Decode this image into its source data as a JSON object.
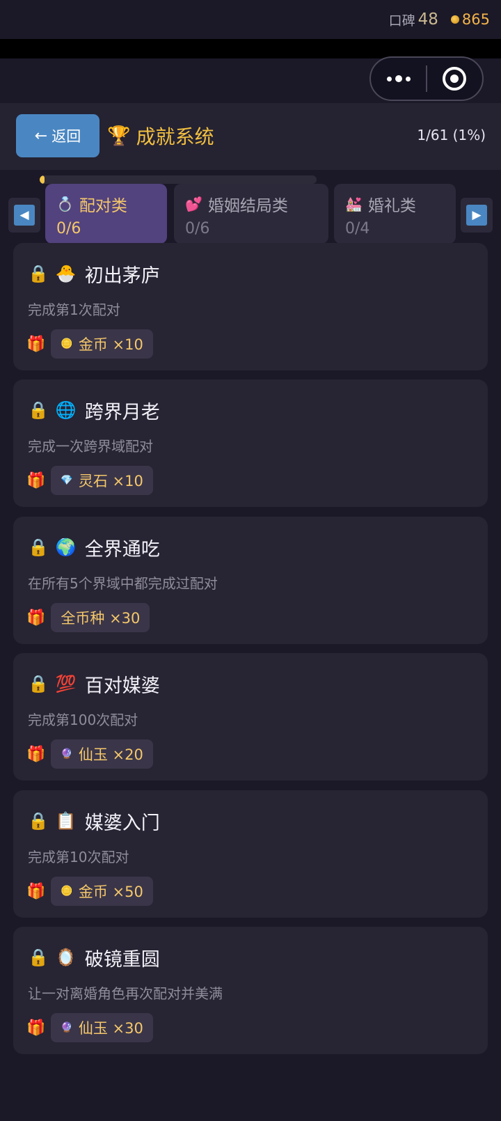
{
  "status": {
    "reputation_label": "口碑",
    "reputation_value": "48",
    "coins_value": "865"
  },
  "header": {
    "back_label": "返回",
    "back_arrow": "←",
    "title": "成就系统",
    "title_icon": "🏆",
    "progress_text": "1/61 (1%)",
    "progress_fraction": 0.0164
  },
  "tabs": {
    "prev_glyph": "◀",
    "next_glyph": "▶",
    "items": [
      {
        "icon": "💍",
        "label": "配对类",
        "count": "0/6",
        "active": true
      },
      {
        "icon": "💕",
        "label": "婚姻结局类",
        "count": "0/6",
        "active": false
      },
      {
        "icon": "💒",
        "label": "婚礼类",
        "count": "0/4",
        "active": false
      }
    ]
  },
  "achievements": [
    {
      "lock": "🔒",
      "emoji": "🐣",
      "name": "初出茅庐",
      "desc": "完成第1次配对",
      "gift": "🎁",
      "reward_icon": "🪙",
      "reward": "金币 ×10"
    },
    {
      "lock": "🔒",
      "emoji": "🌐",
      "name": "跨界月老",
      "desc": "完成一次跨界域配对",
      "gift": "🎁",
      "reward_icon": "💎",
      "reward": "灵石 ×10"
    },
    {
      "lock": "🔒",
      "emoji": "🌍",
      "name": "全界通吃",
      "desc": "在所有5个界域中都完成过配对",
      "gift": "🎁",
      "reward_icon": "",
      "reward": "全币种 ×30"
    },
    {
      "lock": "🔒",
      "emoji": "💯",
      "name": "百对媒婆",
      "desc": "完成第100次配对",
      "gift": "🎁",
      "reward_icon": "🔮",
      "reward": "仙玉 ×20"
    },
    {
      "lock": "🔒",
      "emoji": "📋",
      "name": "媒婆入门",
      "desc": "完成第10次配对",
      "gift": "🎁",
      "reward_icon": "🪙",
      "reward": "金币 ×50"
    },
    {
      "lock": "🔒",
      "emoji": "🪞",
      "name": "破镜重圆",
      "desc": "让一对离婚角色再次配对并美满",
      "gift": "🎁",
      "reward_icon": "🔮",
      "reward": "仙玉 ×30"
    }
  ]
}
